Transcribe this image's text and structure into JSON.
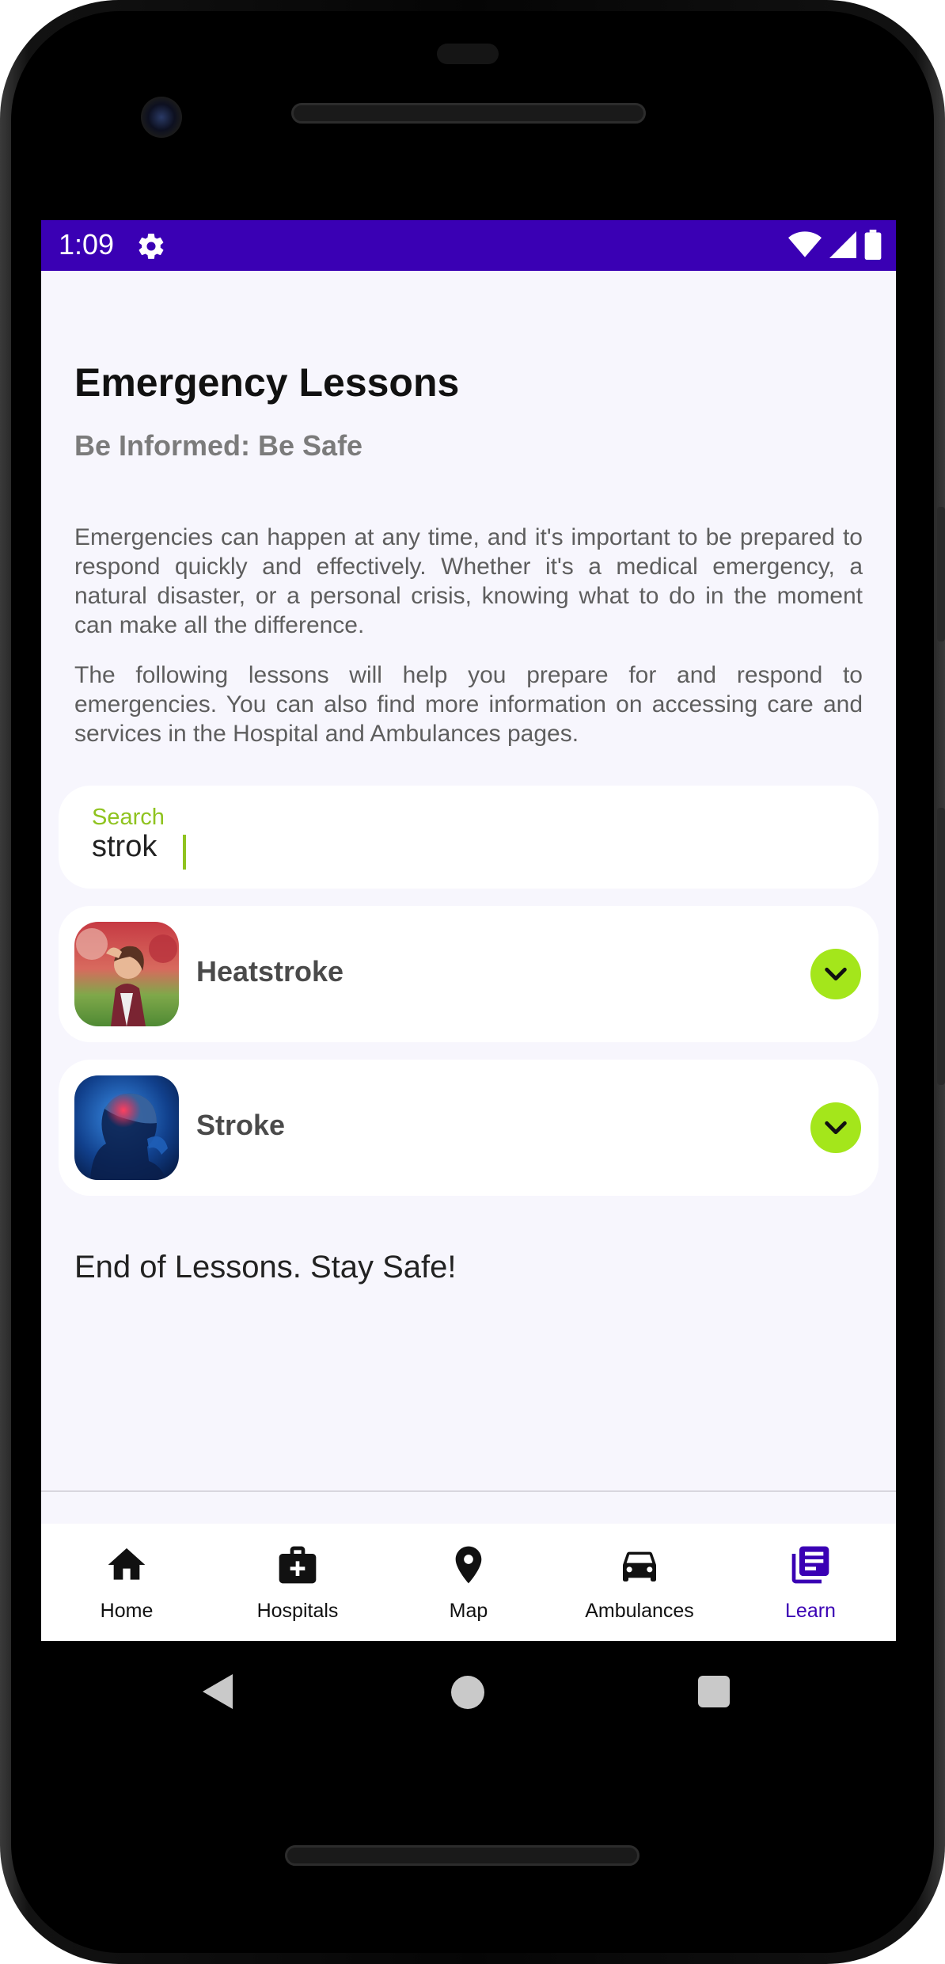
{
  "status_bar": {
    "time": "1:09",
    "background": "#3a00b4"
  },
  "header": {
    "title": "Emergency Lessons",
    "subtitle": "Be Informed: Be Safe"
  },
  "intro": {
    "paragraph1": "Emergencies can happen at any time, and it's important to be prepared to respond quickly and effectively. Whether it's a medical emergency, a natural disaster, or a personal crisis, knowing what to do in the moment can make all the difference.",
    "paragraph2": "The following lessons will help you prepare for and respond to emergencies. You can also find more information on accessing care and services in the Hospital and Ambulances pages."
  },
  "search": {
    "label": "Search",
    "value": "strok",
    "accent": "#8fc31f"
  },
  "lessons": [
    {
      "name": "Heatstroke",
      "icon": "chevron-down-icon"
    },
    {
      "name": "Stroke",
      "icon": "chevron-down-icon"
    }
  ],
  "expand_button_color": "#a4e61b",
  "footer_text": "End of Lessons. Stay Safe!",
  "bottom_nav": {
    "items": [
      {
        "label": "Home",
        "icon": "home-icon"
      },
      {
        "label": "Hospitals",
        "icon": "medical-bag-icon"
      },
      {
        "label": "Map",
        "icon": "map-pin-icon"
      },
      {
        "label": "Ambulances",
        "icon": "car-icon"
      },
      {
        "label": "Learn",
        "icon": "library-books-icon"
      }
    ],
    "active": "Learn",
    "active_color": "#3a00b4"
  }
}
